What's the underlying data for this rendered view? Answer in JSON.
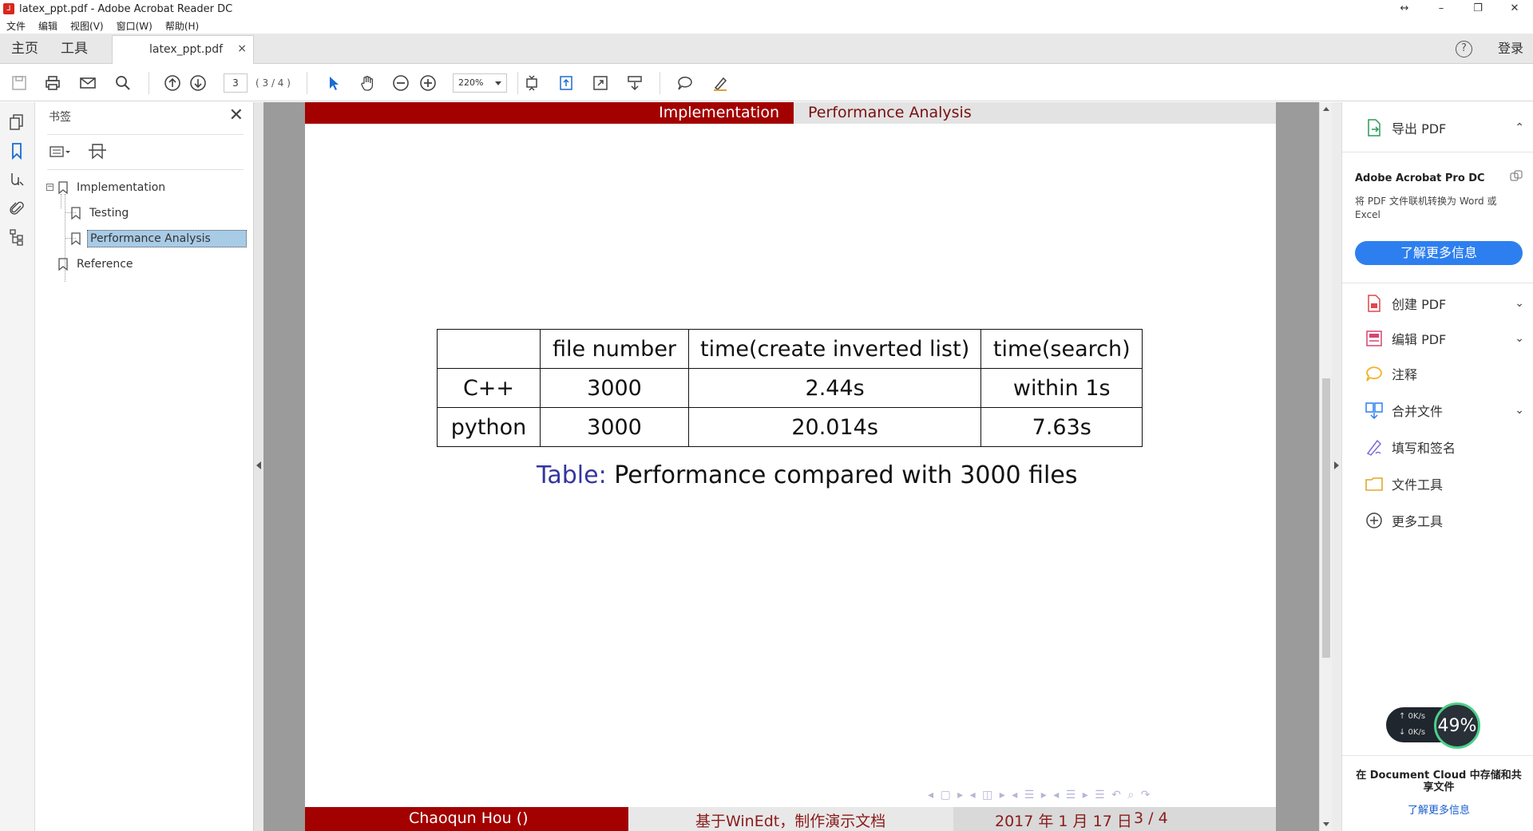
{
  "window": {
    "title": "latex_ppt.pdf - Adobe Acrobat Reader DC",
    "restore_icon": "↔",
    "minimize_icon": "–",
    "maximize_icon": "❐",
    "close_icon": "✕"
  },
  "menu": [
    "文件",
    "编辑",
    "视图(V)",
    "窗口(W)",
    "帮助(H)"
  ],
  "tabs": {
    "home": "主页",
    "tools": "工具",
    "document": "latex_ppt.pdf",
    "close": "×",
    "help": "?",
    "login": "登录"
  },
  "toolbar": {
    "page_number": "3",
    "page_count": "( 3 / 4 )",
    "zoom": "220%"
  },
  "bookmarks": {
    "title": "书签",
    "close": "✕",
    "items": [
      {
        "label": "Implementation",
        "expander": "−"
      },
      {
        "label": "Testing"
      },
      {
        "label": "Performance Analysis"
      },
      {
        "label": "Reference"
      }
    ]
  },
  "slide": {
    "header_left": "Implementation",
    "header_right": "Performance Analysis",
    "table": {
      "headers": [
        "",
        "file number",
        "time(create inverted list)",
        "time(search)"
      ],
      "rows": [
        [
          "C++",
          "3000",
          "2.44s",
          "within 1s"
        ],
        [
          "python",
          "3000",
          "20.014s",
          "7.63s"
        ]
      ]
    },
    "caption_label": "Table:",
    "caption_text": "Performance compared with 3000 files",
    "nav_glyphs": "◂ ▢ ▸ ◂ ◫ ▸ ◂ ☰ ▸ ◂ ☰ ▸   ☰   ↶ ⌕ ↷",
    "footer_author": "Chaoqun Hou ()",
    "footer_middle": "基于WinEdt，制作演示文档",
    "footer_date": "2017 年 1 月 17 日",
    "footer_page": "3 / 4"
  },
  "right_panel": {
    "export_pdf": "导出 PDF",
    "export_chevron": "⌃",
    "promo_title": "Adobe Acrobat Pro DC",
    "promo_desc": "将 PDF 文件联机转换为 Word 或 Excel",
    "promo_button": "了解更多信息",
    "tools": [
      {
        "label": "创建 PDF",
        "chevron": "⌄"
      },
      {
        "label": "编辑 PDF",
        "chevron": "⌄"
      },
      {
        "label": "注释",
        "chevron": ""
      },
      {
        "label": "合并文件",
        "chevron": "⌄"
      },
      {
        "label": "填写和签名",
        "chevron": ""
      },
      {
        "label": "文件工具",
        "chevron": ""
      },
      {
        "label": "更多工具",
        "chevron": ""
      }
    ],
    "cloud_text": "在 Document Cloud 中存储和共享文件",
    "cloud_link": "了解更多信息"
  },
  "net_widget": {
    "up": "↑  0K/s",
    "down": "↓  0K/s",
    "percent": "49%"
  },
  "colors": {
    "beamer_red": "#a30000",
    "accent_blue": "#2d7ff0",
    "caption_blue": "#3535a0",
    "selection": "#a8cbe6"
  }
}
